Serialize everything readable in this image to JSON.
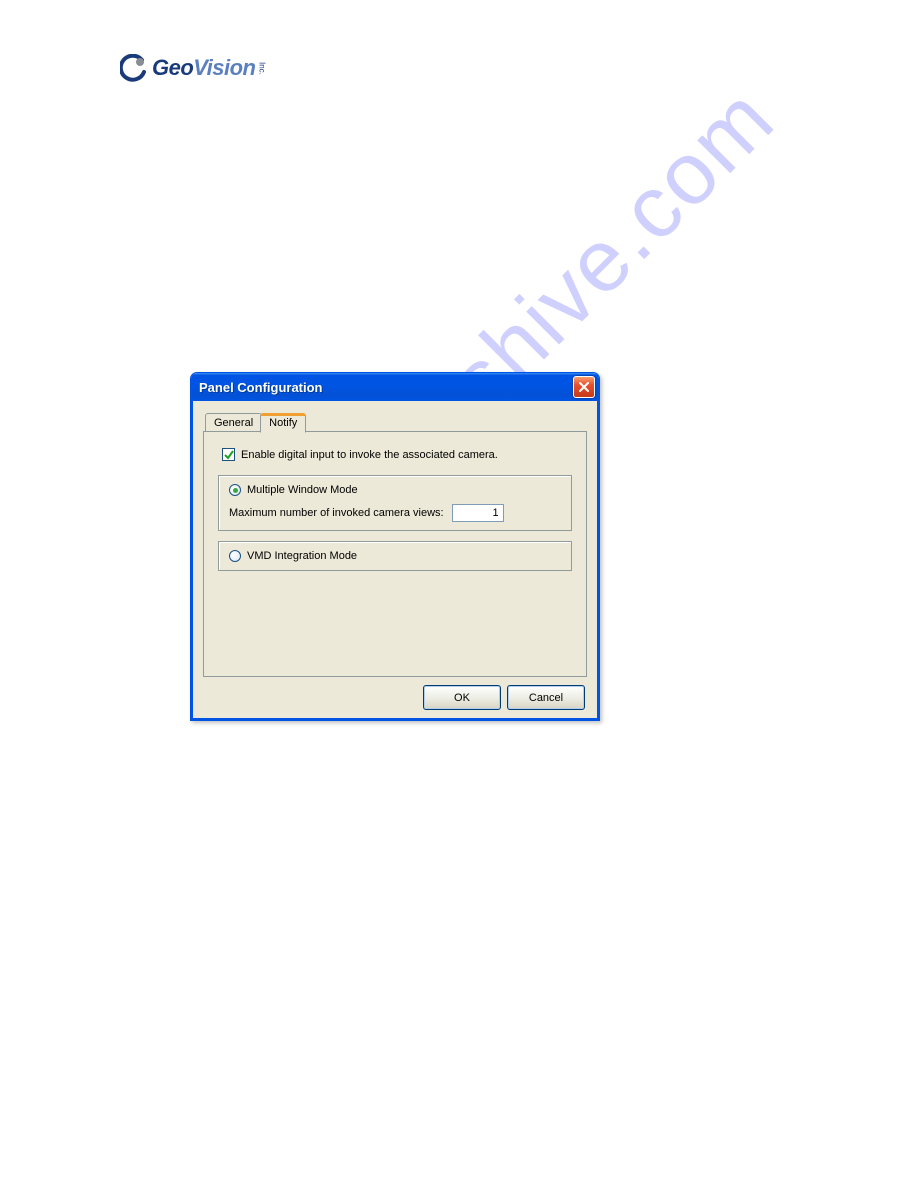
{
  "logo": {
    "brand_prefix": "Geo",
    "brand_suffix": "Vision",
    "sub": "Inc."
  },
  "watermark": "manualshive.com",
  "dialog": {
    "title": "Panel Configuration",
    "tabs": {
      "general": "General",
      "notify": "Notify"
    },
    "enable_checkbox_label": "Enable digital input to invoke the associated camera.",
    "multi_mode": {
      "radio_label": "Multiple Window Mode",
      "sub_label": "Maximum number of invoked camera views:",
      "value": "1"
    },
    "vmd_mode": {
      "radio_label": "VMD Integration Mode"
    },
    "buttons": {
      "ok": "OK",
      "cancel": "Cancel"
    }
  }
}
